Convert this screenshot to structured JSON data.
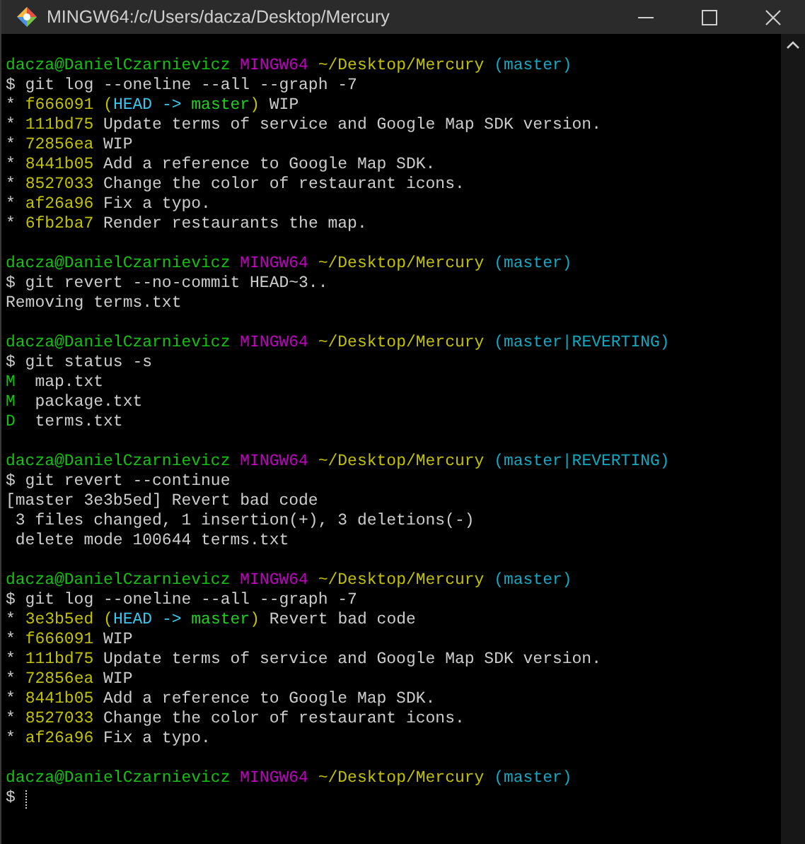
{
  "window": {
    "title": "MINGW64:/c/Users/dacza/Desktop/Mercury"
  },
  "terminal": {
    "blocks": [
      {
        "lines": [
          {
            "segments": [
              {
                "text": "dacza@DanielCzarnievicz",
                "color": "#13c213"
              },
              {
                "text": " MINGW64",
                "color": "#c000c0"
              },
              {
                "text": " ~/Desktop/Mercury",
                "color": "#c1c100"
              },
              {
                "text": " (master)",
                "color": "#11a8c0"
              }
            ]
          },
          {
            "segments": [
              {
                "text": "$ git log --oneline --all --graph -7",
                "color": "#cccccc"
              }
            ]
          },
          {
            "segments": [
              {
                "text": "* ",
                "color": "#cccccc"
              },
              {
                "text": "f666091 (",
                "color": "#c1c100"
              },
              {
                "text": "HEAD -> ",
                "color": "#3ac8f0"
              },
              {
                "text": "master",
                "color": "#20d020"
              },
              {
                "text": ")",
                "color": "#c1c100"
              },
              {
                "text": " WIP",
                "color": "#cccccc"
              }
            ]
          },
          {
            "segments": [
              {
                "text": "* ",
                "color": "#cccccc"
              },
              {
                "text": "111bd75",
                "color": "#c1c100"
              },
              {
                "text": " Update terms of service and Google Map SDK version.",
                "color": "#cccccc"
              }
            ]
          },
          {
            "segments": [
              {
                "text": "* ",
                "color": "#cccccc"
              },
              {
                "text": "72856ea",
                "color": "#c1c100"
              },
              {
                "text": " WIP",
                "color": "#cccccc"
              }
            ]
          },
          {
            "segments": [
              {
                "text": "* ",
                "color": "#cccccc"
              },
              {
                "text": "8441b05",
                "color": "#c1c100"
              },
              {
                "text": " Add a reference to Google Map SDK.",
                "color": "#cccccc"
              }
            ]
          },
          {
            "segments": [
              {
                "text": "* ",
                "color": "#cccccc"
              },
              {
                "text": "8527033",
                "color": "#c1c100"
              },
              {
                "text": " Change the color of restaurant icons.",
                "color": "#cccccc"
              }
            ]
          },
          {
            "segments": [
              {
                "text": "* ",
                "color": "#cccccc"
              },
              {
                "text": "af26a96",
                "color": "#c1c100"
              },
              {
                "text": " Fix a typo.",
                "color": "#cccccc"
              }
            ]
          },
          {
            "segments": [
              {
                "text": "* ",
                "color": "#cccccc"
              },
              {
                "text": "6fb2ba7",
                "color": "#c1c100"
              },
              {
                "text": " Render restaurants the map.",
                "color": "#cccccc"
              }
            ]
          }
        ]
      },
      {
        "lines": [
          {
            "segments": [
              {
                "text": "dacza@DanielCzarnievicz",
                "color": "#13c213"
              },
              {
                "text": " MINGW64",
                "color": "#c000c0"
              },
              {
                "text": " ~/Desktop/Mercury",
                "color": "#c1c100"
              },
              {
                "text": " (master)",
                "color": "#11a8c0"
              }
            ]
          },
          {
            "segments": [
              {
                "text": "$ git revert --no-commit HEAD~3..",
                "color": "#cccccc"
              }
            ]
          },
          {
            "segments": [
              {
                "text": "Removing terms.txt",
                "color": "#cccccc"
              }
            ]
          }
        ]
      },
      {
        "lines": [
          {
            "segments": [
              {
                "text": "dacza@DanielCzarnievicz",
                "color": "#13c213"
              },
              {
                "text": " MINGW64",
                "color": "#c000c0"
              },
              {
                "text": " ~/Desktop/Mercury",
                "color": "#c1c100"
              },
              {
                "text": " (master|REVERTING)",
                "color": "#11a8c0"
              }
            ]
          },
          {
            "segments": [
              {
                "text": "$ git status -s",
                "color": "#cccccc"
              }
            ]
          },
          {
            "segments": [
              {
                "text": "M",
                "color": "#13c213"
              },
              {
                "text": "  map.txt",
                "color": "#cccccc"
              }
            ]
          },
          {
            "segments": [
              {
                "text": "M",
                "color": "#13c213"
              },
              {
                "text": "  package.txt",
                "color": "#cccccc"
              }
            ]
          },
          {
            "segments": [
              {
                "text": "D",
                "color": "#13c213"
              },
              {
                "text": "  terms.txt",
                "color": "#cccccc"
              }
            ]
          }
        ]
      },
      {
        "lines": [
          {
            "segments": [
              {
                "text": "dacza@DanielCzarnievicz",
                "color": "#13c213"
              },
              {
                "text": " MINGW64",
                "color": "#c000c0"
              },
              {
                "text": " ~/Desktop/Mercury",
                "color": "#c1c100"
              },
              {
                "text": " (master|REVERTING)",
                "color": "#11a8c0"
              }
            ]
          },
          {
            "segments": [
              {
                "text": "$ git revert --continue",
                "color": "#cccccc"
              }
            ]
          },
          {
            "segments": [
              {
                "text": "[master 3e3b5ed] Revert bad code",
                "color": "#cccccc"
              }
            ]
          },
          {
            "segments": [
              {
                "text": " 3 files changed, 1 insertion(+), 3 deletions(-)",
                "color": "#cccccc"
              }
            ]
          },
          {
            "segments": [
              {
                "text": " delete mode 100644 terms.txt",
                "color": "#cccccc"
              }
            ]
          }
        ]
      },
      {
        "lines": [
          {
            "segments": [
              {
                "text": "dacza@DanielCzarnievicz",
                "color": "#13c213"
              },
              {
                "text": " MINGW64",
                "color": "#c000c0"
              },
              {
                "text": " ~/Desktop/Mercury",
                "color": "#c1c100"
              },
              {
                "text": " (master)",
                "color": "#11a8c0"
              }
            ]
          },
          {
            "segments": [
              {
                "text": "$ git log --oneline --all --graph -7",
                "color": "#cccccc"
              }
            ]
          },
          {
            "segments": [
              {
                "text": "* ",
                "color": "#cccccc"
              },
              {
                "text": "3e3b5ed (",
                "color": "#c1c100"
              },
              {
                "text": "HEAD -> ",
                "color": "#3ac8f0"
              },
              {
                "text": "master",
                "color": "#20d020"
              },
              {
                "text": ")",
                "color": "#c1c100"
              },
              {
                "text": " Revert bad code",
                "color": "#cccccc"
              }
            ]
          },
          {
            "segments": [
              {
                "text": "* ",
                "color": "#cccccc"
              },
              {
                "text": "f666091",
                "color": "#c1c100"
              },
              {
                "text": " WIP",
                "color": "#cccccc"
              }
            ]
          },
          {
            "segments": [
              {
                "text": "* ",
                "color": "#cccccc"
              },
              {
                "text": "111bd75",
                "color": "#c1c100"
              },
              {
                "text": " Update terms of service and Google Map SDK version.",
                "color": "#cccccc"
              }
            ]
          },
          {
            "segments": [
              {
                "text": "* ",
                "color": "#cccccc"
              },
              {
                "text": "72856ea",
                "color": "#c1c100"
              },
              {
                "text": " WIP",
                "color": "#cccccc"
              }
            ]
          },
          {
            "segments": [
              {
                "text": "* ",
                "color": "#cccccc"
              },
              {
                "text": "8441b05",
                "color": "#c1c100"
              },
              {
                "text": " Add a reference to Google Map SDK.",
                "color": "#cccccc"
              }
            ]
          },
          {
            "segments": [
              {
                "text": "* ",
                "color": "#cccccc"
              },
              {
                "text": "8527033",
                "color": "#c1c100"
              },
              {
                "text": " Change the color of restaurant icons.",
                "color": "#cccccc"
              }
            ]
          },
          {
            "segments": [
              {
                "text": "* ",
                "color": "#cccccc"
              },
              {
                "text": "af26a96",
                "color": "#c1c100"
              },
              {
                "text": " Fix a typo.",
                "color": "#cccccc"
              }
            ]
          }
        ]
      },
      {
        "lines": [
          {
            "segments": [
              {
                "text": "dacza@DanielCzarnievicz",
                "color": "#13c213"
              },
              {
                "text": " MINGW64",
                "color": "#c000c0"
              },
              {
                "text": " ~/Desktop/Mercury",
                "color": "#c1c100"
              },
              {
                "text": " (master)",
                "color": "#11a8c0"
              }
            ]
          },
          {
            "segments": [
              {
                "text": "$",
                "color": "#cccccc"
              }
            ],
            "cursor": true
          }
        ]
      }
    ]
  }
}
